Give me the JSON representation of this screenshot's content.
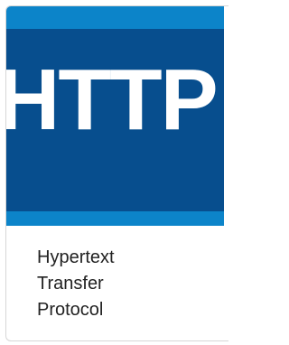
{
  "logo": {
    "text": "HTTP",
    "colors": {
      "outer": "#0c84c9",
      "inner": "#074e8e",
      "text": "#ffffff"
    }
  },
  "caption": {
    "lines": [
      "Hypertext",
      "Transfer",
      "Protocol"
    ]
  }
}
